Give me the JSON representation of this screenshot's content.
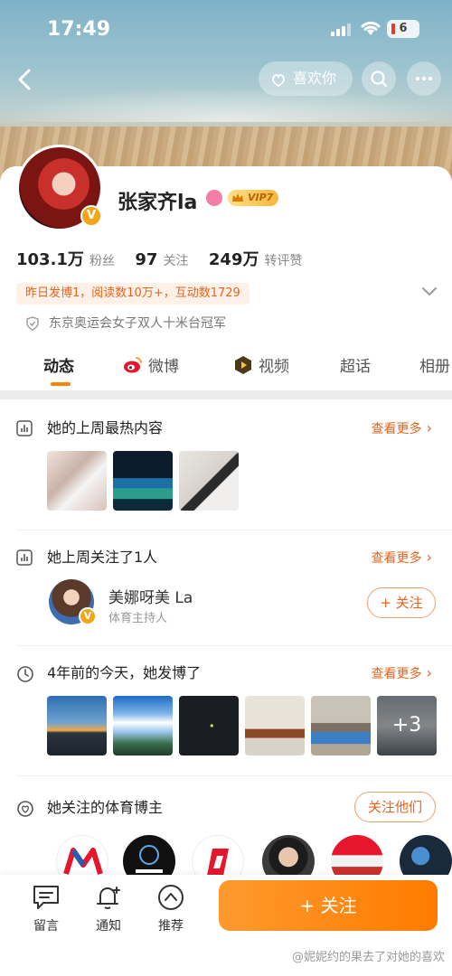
{
  "status_bar": {
    "time": "17:49",
    "battery": "6"
  },
  "header": {
    "like_label": "喜欢你"
  },
  "profile": {
    "name": "张家齐la",
    "vip_level": "VIP7",
    "stats": [
      {
        "value": "103.1万",
        "label": "粉丝"
      },
      {
        "value": "97",
        "label": "关注"
      },
      {
        "value": "249万",
        "label": "转评赞"
      }
    ],
    "activity": "昨日发博1，阅读数10万+，互动数1729",
    "honor": "东京奥运会女子双人十米台冠军",
    "avatar_badge": "V"
  },
  "tabs": [
    {
      "label": "动态"
    },
    {
      "label": "微博"
    },
    {
      "label": "视频"
    },
    {
      "label": "超话"
    },
    {
      "label": "相册"
    }
  ],
  "sections": {
    "hot": {
      "title": "她的上周最热内容",
      "more": "查看更多"
    },
    "followed": {
      "title": "她上周关注了1人",
      "more": "查看更多",
      "user_name": "美娜呀美 La",
      "user_desc": "体育主持人",
      "follow_btn": "+ 关注",
      "badge": "V"
    },
    "memory": {
      "title": "4年前的今天，她发博了",
      "more": "查看更多",
      "extra": "+3"
    },
    "bloggers": {
      "title": "她关注的体育博主",
      "follow_all": "关注他们"
    }
  },
  "bottom_bar": {
    "items": [
      {
        "label": "留言",
        "icon": "message-icon"
      },
      {
        "label": "通知",
        "icon": "bell-icon"
      },
      {
        "label": "推荐",
        "icon": "recommend-icon"
      }
    ],
    "follow_btn": "+ 关注",
    "watermark": "@妮妮约的果去了对她的喜欢"
  },
  "colors": {
    "accent": "#ff8200",
    "accent_text": "#e5641f"
  }
}
